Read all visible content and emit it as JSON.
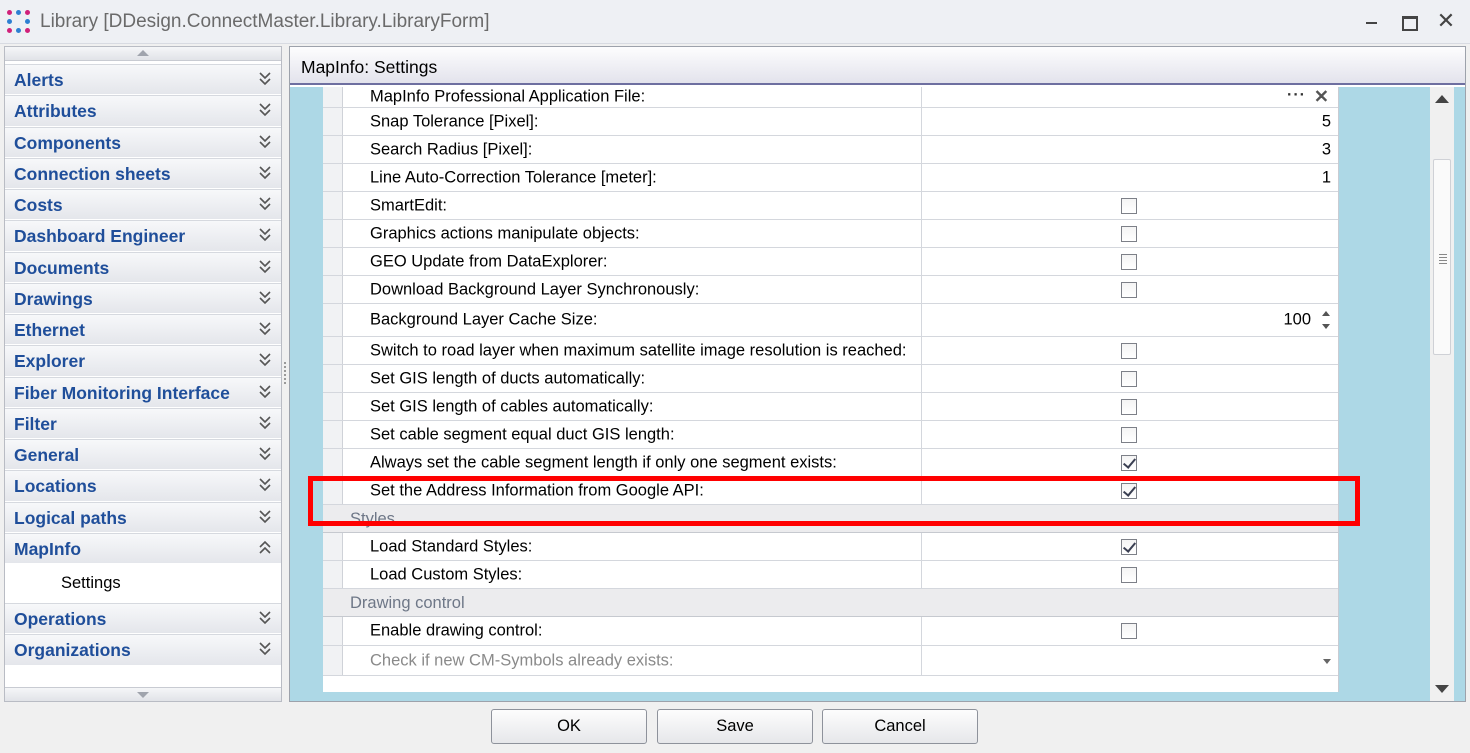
{
  "window": {
    "title": "Library [DDesign.ConnectMaster.Library.LibraryForm]",
    "controls": [
      "minimize",
      "maximize",
      "close"
    ]
  },
  "nav": {
    "items": [
      {
        "label": "Alerts",
        "expanded": false
      },
      {
        "label": "Attributes",
        "expanded": false
      },
      {
        "label": "Components",
        "expanded": false
      },
      {
        "label": "Connection sheets",
        "expanded": false
      },
      {
        "label": "Costs",
        "expanded": false
      },
      {
        "label": "Dashboard Engineer",
        "expanded": false
      },
      {
        "label": "Documents",
        "expanded": false
      },
      {
        "label": "Drawings",
        "expanded": false
      },
      {
        "label": "Ethernet",
        "expanded": false
      },
      {
        "label": "Explorer",
        "expanded": false
      },
      {
        "label": "Fiber Monitoring Interface",
        "expanded": false
      },
      {
        "label": "Filter",
        "expanded": false
      },
      {
        "label": "General",
        "expanded": false
      },
      {
        "label": "Locations",
        "expanded": false
      },
      {
        "label": "Logical paths",
        "expanded": false
      },
      {
        "label": "MapInfo",
        "expanded": true
      },
      {
        "label": "Operations",
        "expanded": false
      },
      {
        "label": "Organizations",
        "expanded": false
      }
    ],
    "sub_item": "Settings"
  },
  "panel": {
    "title": "MapInfo: Settings",
    "rows": [
      {
        "label": "MapInfo Professional Application File:",
        "type": "file",
        "value": ""
      },
      {
        "label": "Snap Tolerance [Pixel]:",
        "type": "number",
        "value": "5"
      },
      {
        "label": "Search Radius [Pixel]:",
        "type": "number",
        "value": "3"
      },
      {
        "label": "Line Auto-Correction Tolerance [meter]:",
        "type": "number",
        "value": "1"
      },
      {
        "label": "SmartEdit:",
        "type": "check",
        "checked": false
      },
      {
        "label": "Graphics actions manipulate objects:",
        "type": "check",
        "checked": false
      },
      {
        "label": "GEO Update from DataExplorer:",
        "type": "check",
        "checked": false
      },
      {
        "label": "Download Background Layer Synchronously:",
        "type": "check",
        "checked": false
      },
      {
        "label": "Background Layer Cache Size:",
        "type": "spin",
        "value": "100"
      },
      {
        "label": "Switch to road layer when maximum satellite image resolution is reached:",
        "type": "check",
        "checked": false
      },
      {
        "label": "Set GIS length of ducts automatically:",
        "type": "check",
        "checked": false
      },
      {
        "label": "Set GIS length of cables automatically:",
        "type": "check",
        "checked": false
      },
      {
        "label": "Set cable segment equal duct GIS length:",
        "type": "check",
        "checked": false
      },
      {
        "label": "Always set the cable segment length if only one segment exists:",
        "type": "check",
        "checked": true
      },
      {
        "label": "Set the Address Information from Google API:",
        "type": "check",
        "checked": true
      }
    ],
    "category_styles": "Styles",
    "styles_rows": [
      {
        "label": "Load Standard Styles:",
        "type": "check",
        "checked": true
      },
      {
        "label": "Load Custom Styles:",
        "type": "check",
        "checked": false
      }
    ],
    "category_drawing": "Drawing control",
    "drawing_rows": [
      {
        "label": "Enable drawing control:",
        "type": "check",
        "checked": false
      },
      {
        "label": "Check if new CM-Symbols already exists:",
        "type": "dropdown",
        "value": ""
      }
    ]
  },
  "buttons": {
    "ok": "OK",
    "save": "Save",
    "cancel": "Cancel"
  },
  "highlight_color": "#ff0000",
  "nav_label_color": "#1f4e9a",
  "grid_side_color": "#add8e6"
}
